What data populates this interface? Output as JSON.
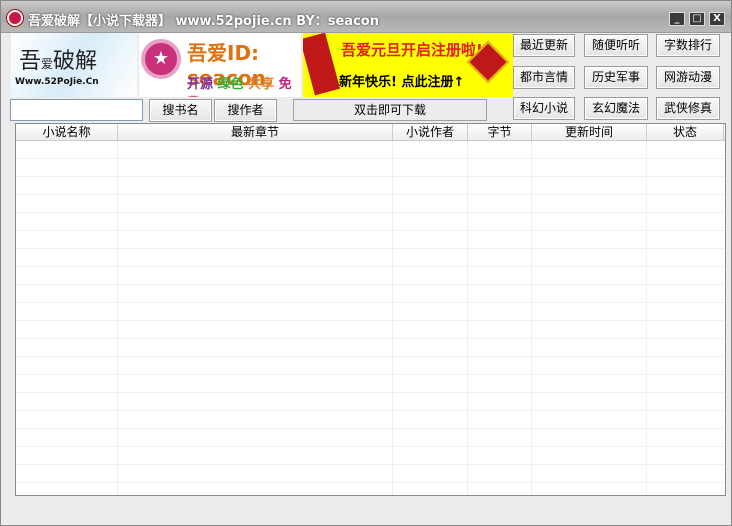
{
  "window": {
    "title": "吾爱破解【小说下载器】 www.52pojie.cn BY：seacon",
    "minimize": "_",
    "maximize": "□",
    "close": "X"
  },
  "banners": {
    "logo_text": "吾爱破解 Www.52PoJie.Cn CRACK",
    "ad1_title": "吾爱ID: seacon",
    "ad1_tags": [
      "开源",
      "绿色",
      "共享",
      "免费"
    ],
    "ad2_line1": "吾爱元旦开启注册啦!",
    "ad2_line2": "新年快乐! 点此注册↑"
  },
  "search": {
    "value": "",
    "placeholder": "",
    "by_name": "搜书名",
    "by_author": "搜作者"
  },
  "status": "双击即可下载",
  "categories": [
    "最近更新",
    "随便听听",
    "字数排行",
    "都市言情",
    "历史军事",
    "网游动漫",
    "科幻小说",
    "玄幻魔法",
    "武侠修真"
  ],
  "table": {
    "columns": [
      "小说名称",
      "最新章节",
      "小说作者",
      "字节",
      "更新时间",
      "状态"
    ],
    "rows": []
  }
}
